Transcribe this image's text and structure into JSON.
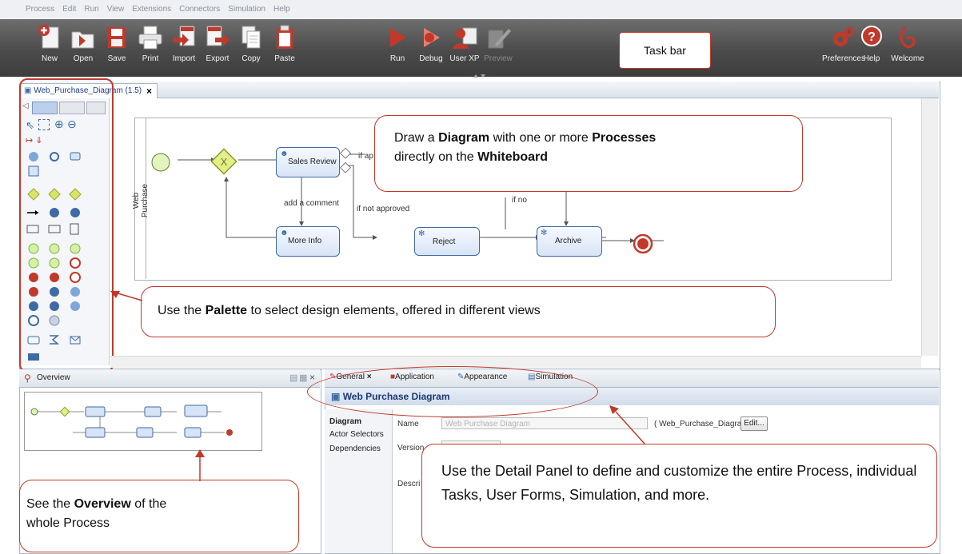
{
  "menu": [
    "Process",
    "Edit",
    "Run",
    "View",
    "Extensions",
    "Connectors",
    "Simulation",
    "Help"
  ],
  "toolbar": {
    "new": "New",
    "open": "Open",
    "save": "Save",
    "print": "Print",
    "import": "Import",
    "export": "Export",
    "copy": "Copy",
    "paste": "Paste",
    "run": "Run",
    "debug": "Debug",
    "userxp": "User XP",
    "preview": "Preview",
    "preferences": "Preferences",
    "help": "Help",
    "welcome": "Welcome"
  },
  "taskbar_callout": "Task bar",
  "editor": {
    "tab_title": "Web_Purchase_Diagram (1.5)",
    "pool_name": "Web Purchase",
    "tasks": {
      "sales_review": "Sales Review",
      "more_info": "More Info",
      "reject": "Reject",
      "archive": "Archive"
    },
    "flows": {
      "if_approved": "if ap",
      "add_comment": "add a comment",
      "if_not_approved": "if not approved",
      "if_no": "if no"
    }
  },
  "callouts": {
    "whiteboard": {
      "p1": "Draw a ",
      "b1": "Diagram",
      "p2": " with one or more ",
      "b2": "Processes",
      "p3": "directly on the ",
      "b3": "Whiteboard"
    },
    "palette": {
      "p1": "Use the ",
      "b1": "Palette",
      "p2": " to select design elements, offered in different views"
    },
    "overview": {
      "p1": "See the ",
      "b1": "Overview",
      "p2": " of the",
      "p3": "whole Process"
    },
    "detail": {
      "text": "Use the Detail Panel to define and customize the entire Process, individual Tasks, User Forms, Simulation, and more."
    }
  },
  "overview_panel": {
    "title": "Overview"
  },
  "detail_panel": {
    "tabs": [
      "General",
      "Application",
      "Appearance",
      "Simulation"
    ],
    "title": "Web Purchase Diagram",
    "nav": [
      "Diagram",
      "Actor Selectors",
      "Dependencies"
    ],
    "name_label": "Name",
    "name_value": "Web Purchase Diagram",
    "name_id": "( Web_Purchase_Diagram )",
    "edit_button": "Edit...",
    "version_label": "Version",
    "desc_label": "Descri"
  },
  "colors": {
    "accent": "#c0392b",
    "task_border": "#3e6aa5",
    "gateway": "#c9d94a",
    "start": "#d7f0a6",
    "end": "#c0392b"
  }
}
